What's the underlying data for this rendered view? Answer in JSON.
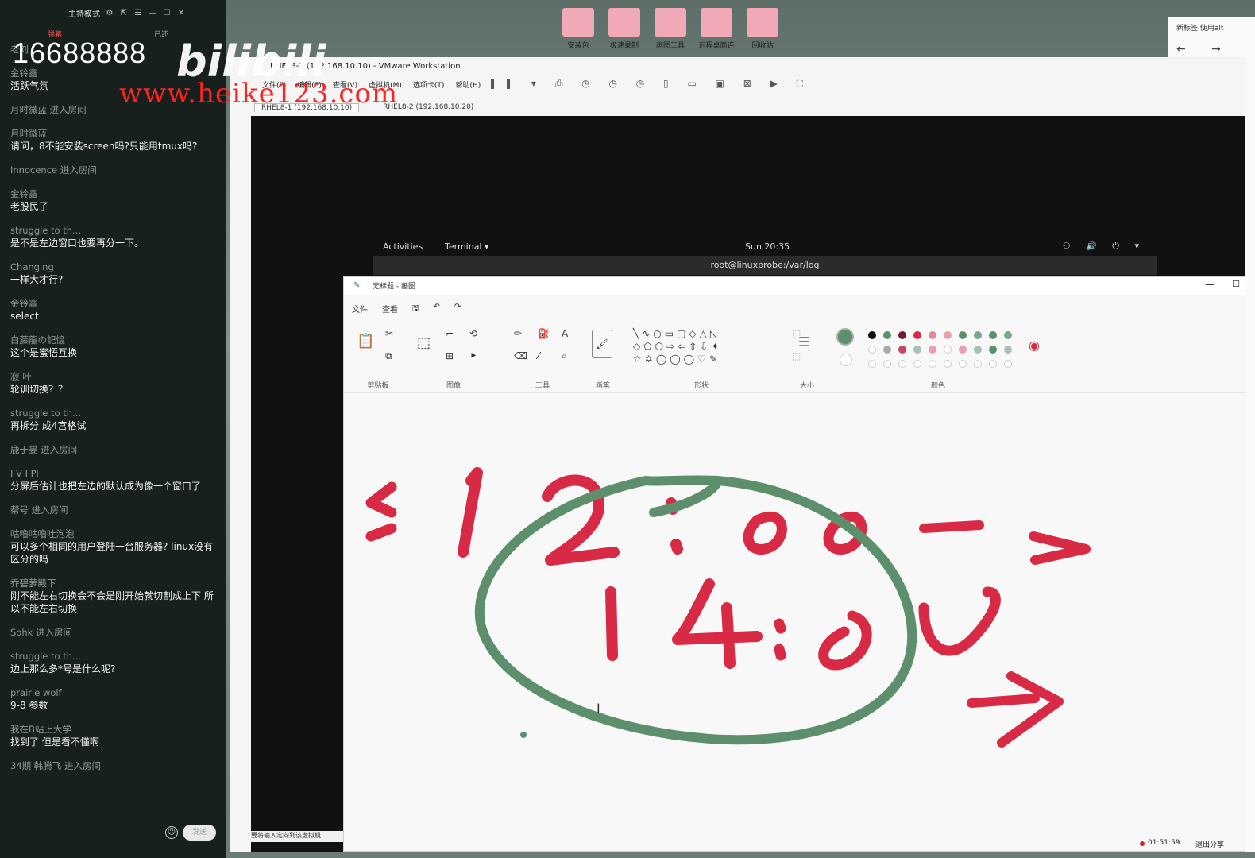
{
  "chat": {
    "title": "主持模式",
    "tab_a": "弹幕",
    "tab_b": "已还",
    "messages": [
      {
        "who": "老刘",
        "text": "",
        "enter": false
      },
      {
        "who": "金铃鑫",
        "text": "活跃气氛",
        "enter": false
      },
      {
        "who": "",
        "text": "",
        "enter": true,
        "line": "月时微蓝 进入房间"
      },
      {
        "who": "月时微蓝",
        "text": "请问，8不能安装screen吗?只能用tmux吗?",
        "enter": false
      },
      {
        "who": "",
        "text": "",
        "enter": true,
        "line": "Innocence 进入房间"
      },
      {
        "who": "金铃鑫",
        "text": "老股民了",
        "enter": false
      },
      {
        "who": "struggle to th...",
        "text": "是不是左边窗口也要再分一下。",
        "enter": false
      },
      {
        "who": "Changing",
        "text": "一样大才行?",
        "enter": false
      },
      {
        "who": "金铃鑫",
        "text": "select",
        "enter": false
      },
      {
        "who": "白藤龍の記憶",
        "text": "这个是蜜悟互换",
        "enter": false
      },
      {
        "who": "寂 叶",
        "text": "轮训切换？？",
        "enter": false
      },
      {
        "who": "struggle to th...",
        "text": "再拆分 成4宫格试",
        "enter": false
      },
      {
        "who": "",
        "text": "",
        "enter": true,
        "line": "鹿于晏 进入房间"
      },
      {
        "who": "I V I Pl",
        "text": "分屏后估计也把左边的默认成为像一个窗口了",
        "enter": false
      },
      {
        "who": "",
        "text": "",
        "enter": true,
        "line": "帮号 进入房间"
      },
      {
        "who": "咕噜咕噜吐泡泡",
        "text": "可以多个相同的用户登陆一台服务器? linux没有区分的吗",
        "enter": false
      },
      {
        "who": "乔碧萝殿下",
        "text": "刚不能左右切换会不会是刚开始就切割成上下 所以不能左右切换",
        "enter": false
      },
      {
        "who": "",
        "text": "",
        "enter": true,
        "line": "Sohk 进入房间"
      },
      {
        "who": "struggle to th...",
        "text": "边上那么多*号是什么呢?",
        "enter": false
      },
      {
        "who": "prairie wolf",
        "text": "9-8 参数",
        "enter": false
      },
      {
        "who": "我在B站上大学",
        "text": "找到了 但是看不懂啊",
        "enter": false
      },
      {
        "who": "",
        "text": "",
        "enter": true,
        "line": "34期 韩腾飞 进入房间"
      }
    ],
    "send_label": "发送"
  },
  "watermark": {
    "number": "16688888",
    "logo": "bilibili",
    "site": "www.heike123.com"
  },
  "desktop_icons": [
    "安装包",
    "极速录制",
    "画图工具",
    "远程桌面连",
    "回收站"
  ],
  "browser": {
    "tab": "新标签 使用alt",
    "nav": "← → ⟳ ⌂"
  },
  "vmware": {
    "title": "RHEL8-1 (192.168.10.10) - VMware Workstation",
    "menu": [
      "文件(F)",
      "编辑(E)",
      "查看(V)",
      "虚拟机(M)",
      "选项卡(T)",
      "帮助(H)"
    ],
    "tabs": [
      "RHEL8-1 (192.168.10.10)",
      "RHEL8-2 (192.168.10.20)"
    ],
    "status": "要将输入定向到该虚拟机..."
  },
  "gnome": {
    "activities": "Activities",
    "terminal": "Terminal ▾",
    "clock": "Sun 20:35",
    "tray": "⚇ 🔊 ⏻ ▾",
    "terminal_title": "root@linuxprobe:/var/log"
  },
  "paint": {
    "title": "无标题 - 画图",
    "menu": [
      "文件",
      "查看"
    ],
    "groups": [
      "剪贴板",
      "图像",
      "工具",
      "画笔",
      "形状",
      "大小",
      "颜色"
    ],
    "record_time": "01:51:59",
    "exit_share": "退出分享",
    "colors": {
      "ink_red": "#d92a45",
      "ink_green": "#5e8f6c"
    }
  }
}
